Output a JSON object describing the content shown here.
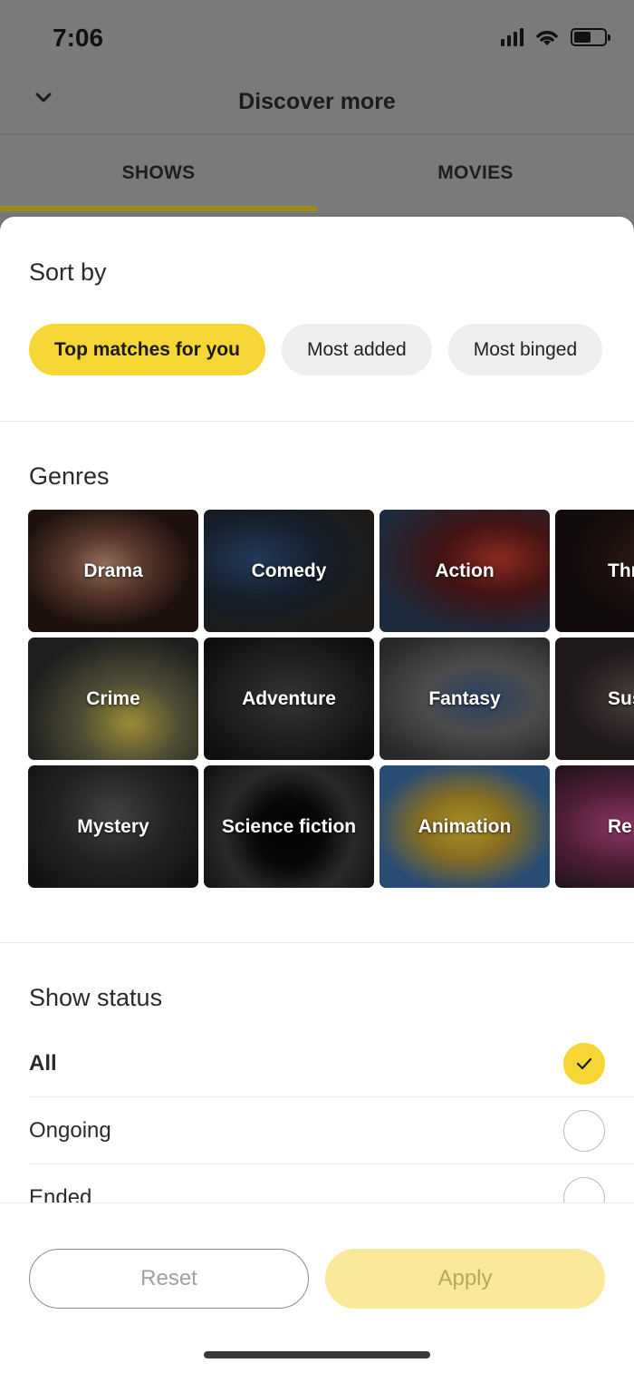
{
  "status_bar": {
    "time": "7:06",
    "battery_level": 0.55
  },
  "header": {
    "title": "Discover more",
    "back_icon": "chevron-down-icon"
  },
  "tabs": [
    {
      "label": "SHOWS",
      "active": true
    },
    {
      "label": "MOVIES",
      "active": false
    }
  ],
  "sort": {
    "title": "Sort by",
    "chips": [
      {
        "label": "Top matches for you",
        "selected": true
      },
      {
        "label": "Most added",
        "selected": false
      },
      {
        "label": "Most binged",
        "selected": false
      }
    ]
  },
  "genres": {
    "title": "Genres",
    "items": [
      {
        "label": "Drama"
      },
      {
        "label": "Comedy"
      },
      {
        "label": "Action"
      },
      {
        "label": "Thr"
      },
      {
        "label": "Crime"
      },
      {
        "label": "Adventure"
      },
      {
        "label": "Fantasy"
      },
      {
        "label": "Susp"
      },
      {
        "label": "Mystery"
      },
      {
        "label": "Science fiction"
      },
      {
        "label": "Animation"
      },
      {
        "label": "Re"
      }
    ]
  },
  "show_status": {
    "title": "Show status",
    "options": [
      {
        "label": "All",
        "checked": true
      },
      {
        "label": "Ongoing",
        "checked": false
      },
      {
        "label": "Ended",
        "checked": false
      }
    ]
  },
  "footer": {
    "reset_label": "Reset",
    "apply_label": "Apply"
  },
  "colors": {
    "accent": "#f6d634",
    "apply_disabled": "#fbe99a",
    "dim_overlay": "#777777"
  }
}
